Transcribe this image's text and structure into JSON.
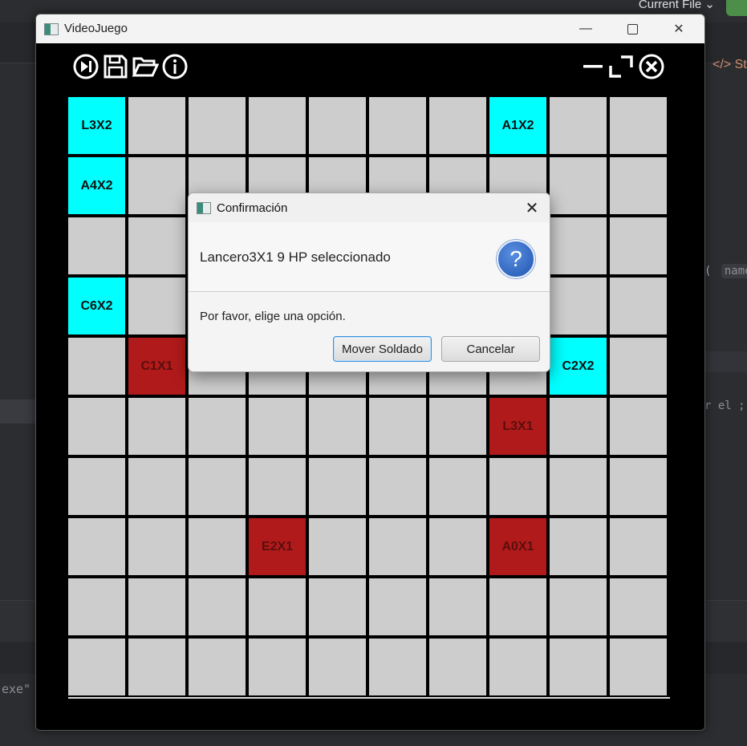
{
  "ide": {
    "current_file_label": "Current File ⌄",
    "tab_label": "</> St",
    "code_line_1": "( ",
    "code_hint": "name",
    "code_line_2": "r el ;",
    "code_line_3": "exe\""
  },
  "window": {
    "title": "VideoJuego"
  },
  "toolbar": {
    "icons": [
      "skip-forward-icon",
      "save-icon",
      "folder-open-icon",
      "info-icon",
      "minimize-icon",
      "maximize-icon",
      "close-circle-icon"
    ]
  },
  "board": {
    "rows": [
      [
        {
          "label": "L3X2",
          "team": "cyan"
        },
        {
          "label": "",
          "team": ""
        },
        {
          "label": "",
          "team": ""
        },
        {
          "label": "",
          "team": ""
        },
        {
          "label": "",
          "team": ""
        },
        {
          "label": "",
          "team": ""
        },
        {
          "label": "",
          "team": ""
        },
        {
          "label": "A1X2",
          "team": "cyan"
        },
        {
          "label": "",
          "team": ""
        },
        {
          "label": "",
          "team": ""
        }
      ],
      [
        {
          "label": "A4X2",
          "team": "cyan"
        },
        {
          "label": "",
          "team": ""
        },
        {
          "label": "",
          "team": ""
        },
        {
          "label": "",
          "team": ""
        },
        {
          "label": "",
          "team": ""
        },
        {
          "label": "",
          "team": ""
        },
        {
          "label": "",
          "team": ""
        },
        {
          "label": "",
          "team": ""
        },
        {
          "label": "",
          "team": ""
        },
        {
          "label": "",
          "team": ""
        }
      ],
      [
        {
          "label": "",
          "team": ""
        },
        {
          "label": "",
          "team": ""
        },
        {
          "label": "",
          "team": ""
        },
        {
          "label": "",
          "team": ""
        },
        {
          "label": "",
          "team": ""
        },
        {
          "label": "",
          "team": ""
        },
        {
          "label": "",
          "team": ""
        },
        {
          "label": "",
          "team": ""
        },
        {
          "label": "",
          "team": ""
        },
        {
          "label": "",
          "team": ""
        }
      ],
      [
        {
          "label": "C6X2",
          "team": "cyan"
        },
        {
          "label": "",
          "team": ""
        },
        {
          "label": "",
          "team": ""
        },
        {
          "label": "",
          "team": ""
        },
        {
          "label": "",
          "team": ""
        },
        {
          "label": "",
          "team": ""
        },
        {
          "label": "",
          "team": ""
        },
        {
          "label": "",
          "team": ""
        },
        {
          "label": "",
          "team": ""
        },
        {
          "label": "",
          "team": ""
        }
      ],
      [
        {
          "label": "",
          "team": ""
        },
        {
          "label": "C1X1",
          "team": "red"
        },
        {
          "label": "",
          "team": ""
        },
        {
          "label": "",
          "team": ""
        },
        {
          "label": "",
          "team": ""
        },
        {
          "label": "",
          "team": ""
        },
        {
          "label": "",
          "team": ""
        },
        {
          "label": "",
          "team": ""
        },
        {
          "label": "C2X2",
          "team": "cyan"
        },
        {
          "label": "",
          "team": ""
        }
      ],
      [
        {
          "label": "",
          "team": ""
        },
        {
          "label": "",
          "team": ""
        },
        {
          "label": "",
          "team": ""
        },
        {
          "label": "",
          "team": ""
        },
        {
          "label": "",
          "team": ""
        },
        {
          "label": "",
          "team": ""
        },
        {
          "label": "",
          "team": ""
        },
        {
          "label": "L3X1",
          "team": "red"
        },
        {
          "label": "",
          "team": ""
        },
        {
          "label": "",
          "team": ""
        }
      ],
      [
        {
          "label": "",
          "team": ""
        },
        {
          "label": "",
          "team": ""
        },
        {
          "label": "",
          "team": ""
        },
        {
          "label": "",
          "team": ""
        },
        {
          "label": "",
          "team": ""
        },
        {
          "label": "",
          "team": ""
        },
        {
          "label": "",
          "team": ""
        },
        {
          "label": "",
          "team": ""
        },
        {
          "label": "",
          "team": ""
        },
        {
          "label": "",
          "team": ""
        }
      ],
      [
        {
          "label": "",
          "team": ""
        },
        {
          "label": "",
          "team": ""
        },
        {
          "label": "",
          "team": ""
        },
        {
          "label": "E2X1",
          "team": "red"
        },
        {
          "label": "",
          "team": ""
        },
        {
          "label": "",
          "team": ""
        },
        {
          "label": "",
          "team": ""
        },
        {
          "label": "A0X1",
          "team": "red"
        },
        {
          "label": "",
          "team": ""
        },
        {
          "label": "",
          "team": ""
        }
      ],
      [
        {
          "label": "",
          "team": ""
        },
        {
          "label": "",
          "team": ""
        },
        {
          "label": "",
          "team": ""
        },
        {
          "label": "",
          "team": ""
        },
        {
          "label": "",
          "team": ""
        },
        {
          "label": "",
          "team": ""
        },
        {
          "label": "",
          "team": ""
        },
        {
          "label": "",
          "team": ""
        },
        {
          "label": "",
          "team": ""
        },
        {
          "label": "",
          "team": ""
        }
      ],
      [
        {
          "label": "",
          "team": ""
        },
        {
          "label": "",
          "team": ""
        },
        {
          "label": "",
          "team": ""
        },
        {
          "label": "",
          "team": ""
        },
        {
          "label": "",
          "team": ""
        },
        {
          "label": "",
          "team": ""
        },
        {
          "label": "",
          "team": ""
        },
        {
          "label": "",
          "team": ""
        },
        {
          "label": "",
          "team": ""
        },
        {
          "label": "",
          "team": ""
        }
      ]
    ]
  },
  "dialog": {
    "title": "Confirmación",
    "header": "Lancero3X1 9 HP seleccionado",
    "message": "Por favor, elige una opción.",
    "primary_button": "Mover Soldado",
    "cancel_button": "Cancelar",
    "icon": "question-icon",
    "close_glyph": "✕"
  },
  "colors": {
    "team_cyan": "#00ffff",
    "team_red": "#b11a1a",
    "empty_cell": "#cdcdcd",
    "board_background": "#000000"
  }
}
